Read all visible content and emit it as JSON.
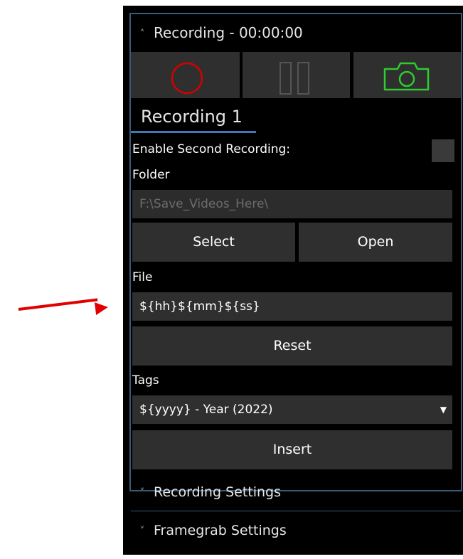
{
  "header": {
    "title": "Recording - 00:00:00"
  },
  "record_buttons": {
    "record_icon": "record-circle-icon",
    "pause_icon": "pause-icon",
    "snapshot_icon": "camera-icon"
  },
  "tab": {
    "label": "Recording 1"
  },
  "enable_second": {
    "label": "Enable Second Recording:",
    "checked": false
  },
  "folder": {
    "label": "Folder",
    "placeholder": "F:\\Save_Videos_Here\\",
    "select_label": "Select",
    "open_label": "Open"
  },
  "file": {
    "label": "File",
    "value": "${hh}${mm}${ss}",
    "reset_label": "Reset"
  },
  "tags": {
    "label": "Tags",
    "selected": "${yyyy} - Year (2022)",
    "insert_label": "Insert"
  },
  "sections": {
    "recording_settings": "Recording Settings",
    "framegrab_settings": "Framegrab Settings"
  },
  "colors": {
    "accent": "#3b79b7",
    "record": "#d40000",
    "camera": "#2ecc2e",
    "annotation_arrow": "#e00000"
  }
}
